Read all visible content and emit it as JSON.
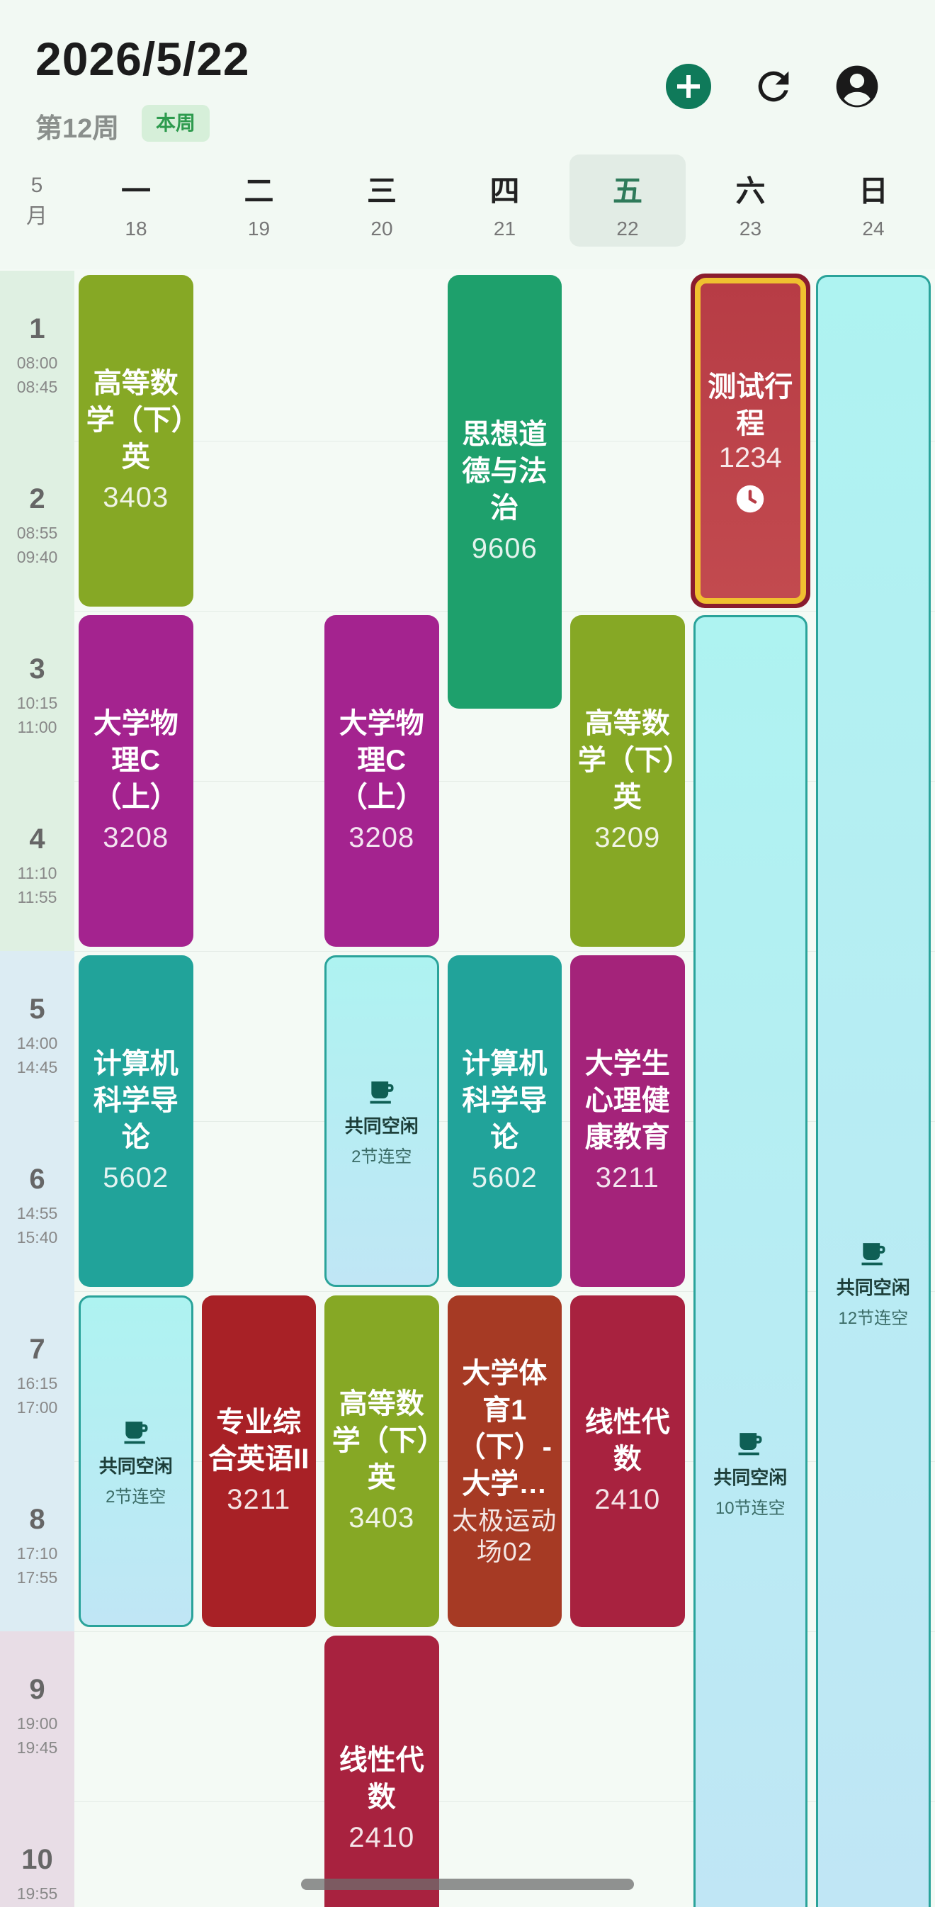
{
  "header": {
    "date": "2026/5/22",
    "week_label": "第12周",
    "week_badge": "本周"
  },
  "icons": {
    "add": "plus-circle-icon",
    "refresh": "refresh-icon",
    "account": "account-circle-icon",
    "free": "coffee-cup-icon",
    "reminder": "clock-icon"
  },
  "month": {
    "num": "5",
    "unit": "月"
  },
  "days": [
    {
      "name": "一",
      "date": "18"
    },
    {
      "name": "二",
      "date": "19"
    },
    {
      "name": "三",
      "date": "20"
    },
    {
      "name": "四",
      "date": "21"
    },
    {
      "name": "五",
      "date": "22",
      "today": true
    },
    {
      "name": "六",
      "date": "23"
    },
    {
      "name": "日",
      "date": "24"
    }
  ],
  "periods": [
    {
      "num": "1",
      "start": "08:00",
      "end": "08:45"
    },
    {
      "num": "2",
      "start": "08:55",
      "end": "09:40"
    },
    {
      "num": "3",
      "start": "10:15",
      "end": "11:00"
    },
    {
      "num": "4",
      "start": "11:10",
      "end": "11:55"
    },
    {
      "num": "5",
      "start": "14:00",
      "end": "14:45"
    },
    {
      "num": "6",
      "start": "14:55",
      "end": "15:40"
    },
    {
      "num": "7",
      "start": "16:15",
      "end": "17:00"
    },
    {
      "num": "8",
      "start": "17:10",
      "end": "17:55"
    },
    {
      "num": "9",
      "start": "19:00",
      "end": "19:45"
    },
    {
      "num": "10",
      "start": "19:55",
      "end": ""
    }
  ],
  "courses": [
    {
      "day": 1,
      "start": 1,
      "span": 2,
      "name": "高等数学（下）英",
      "room": "3403",
      "color": "#86a825"
    },
    {
      "day": 1,
      "start": 3,
      "span": 2,
      "name": "大学物理C（上）",
      "room": "3208",
      "color": "#a4238f"
    },
    {
      "day": 1,
      "start": 5,
      "span": 2,
      "name": "计算机科学导论",
      "room": "5602",
      "color": "#21a39a"
    },
    {
      "day": 2,
      "start": 7,
      "span": 2,
      "name": "专业综合英语II",
      "room": "3211",
      "color": "#a82126"
    },
    {
      "day": 3,
      "start": 3,
      "span": 2,
      "name": "大学物理C（上）",
      "room": "3208",
      "color": "#a4238f"
    },
    {
      "day": 3,
      "start": 7,
      "span": 2,
      "name": "高等数学（下）英",
      "room": "3403",
      "color": "#86a825"
    },
    {
      "day": 3,
      "start": 9,
      "span": 2,
      "name": "线性代数",
      "room": "2410",
      "color": "#a8223f"
    },
    {
      "day": 4,
      "start": 1,
      "span": 2.6,
      "name": "思想道德与法治",
      "room": "9606",
      "color": "#1ea06c"
    },
    {
      "day": 4,
      "start": 5,
      "span": 2,
      "name": "计算机科学导论",
      "room": "5602",
      "color": "#21a39a"
    },
    {
      "day": 4,
      "start": 7,
      "span": 2,
      "name": "大学体育1（下）-大学…",
      "room": "太极运动场02",
      "color": "#a63a24",
      "smallroom": true
    },
    {
      "day": 5,
      "start": 3,
      "span": 2,
      "name": "高等数学（下）英",
      "room": "3209",
      "color": "#86a825"
    },
    {
      "day": 5,
      "start": 5,
      "span": 2,
      "name": "大学生心理健康教育",
      "room": "3211",
      "color": "#a4237a"
    },
    {
      "day": 5,
      "start": 7,
      "span": 2,
      "name": "线性代数",
      "room": "2410",
      "color": "#a8223f"
    }
  ],
  "special": {
    "day": 6,
    "start": 1,
    "span": 2,
    "name": "测试行程",
    "room": "1234"
  },
  "free_slots": [
    {
      "day": 1,
      "start": 7,
      "span": 2,
      "label": "共同空闲",
      "sub": "2节连空"
    },
    {
      "day": 3,
      "start": 5,
      "span": 2,
      "label": "共同空闲",
      "sub": "2节连空"
    },
    {
      "day": 6,
      "start": 3,
      "span": 10,
      "label": "共同空闲",
      "sub": "10节连空"
    },
    {
      "day": 7,
      "start": 1,
      "span": 12,
      "label": "共同空闲",
      "sub": "12节连空"
    }
  ]
}
